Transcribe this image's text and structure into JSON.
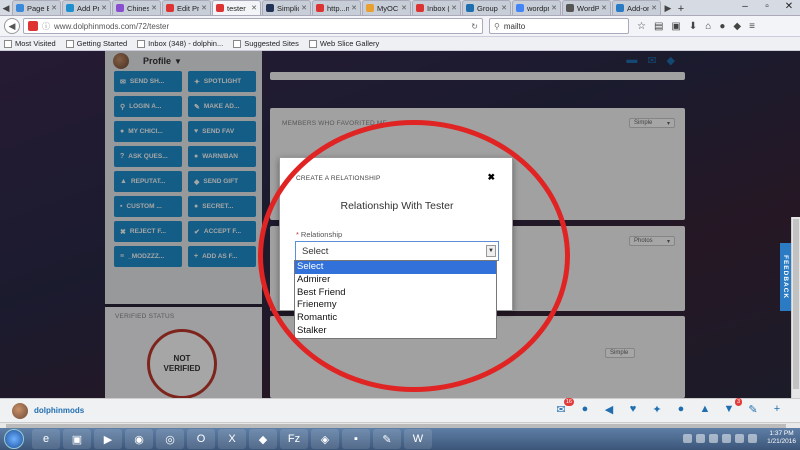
{
  "browser": {
    "tabs": [
      {
        "label": "Page Buil...",
        "icon_color": "#3b8ad9",
        "active": false
      },
      {
        "label": "Add Prod...",
        "icon_color": "#1f8fce",
        "active": false
      },
      {
        "label": "Chinese ...",
        "icon_color": "#8a4fd0",
        "active": false
      },
      {
        "label": "Edit Profile",
        "icon_color": "#d33",
        "active": false
      },
      {
        "label": "tester",
        "icon_color": "#d33",
        "active": true
      },
      {
        "label": "Simplicity",
        "icon_color": "#235",
        "active": false
      },
      {
        "label": "http...mods",
        "icon_color": "#d33",
        "active": false
      },
      {
        "label": "MyOC · D...",
        "icon_color": "#e8a030",
        "active": false
      },
      {
        "label": "Inbox (32...",
        "icon_color": "#d33",
        "active": false
      },
      {
        "label": "Group RS...",
        "icon_color": "#1f6fb0",
        "active": false
      },
      {
        "label": "wordpres...",
        "icon_color": "#4285f4",
        "active": false
      },
      {
        "label": "WordPres...",
        "icon_color": "#555",
        "active": false
      },
      {
        "label": "Add-ons ...",
        "icon_color": "#2a7bc4",
        "active": false
      }
    ],
    "url": "www.dolphinmods.com/72/tester",
    "search_value": "mailto",
    "bookmarks": [
      "Most Visited",
      "Getting Started",
      "Inbox (348) - dolphin...",
      "Suggested Sites",
      "Web Slice Gallery"
    ]
  },
  "page": {
    "profile_label": "Profile",
    "top_buttons": [
      "",
      ""
    ],
    "buttons": [
      {
        "label": "SEND SH...",
        "icon": "megaphone-icon",
        "glyph": "✉"
      },
      {
        "label": "SPOTLIGHT",
        "icon": "spotlight-icon",
        "glyph": "✦"
      },
      {
        "label": "LOGIN A...",
        "icon": "search-icon",
        "glyph": "⚲"
      },
      {
        "label": "MAKE AD...",
        "icon": "pen-icon",
        "glyph": "✎"
      },
      {
        "label": "MY CHICI...",
        "icon": "chat-icon",
        "glyph": "●"
      },
      {
        "label": "SEND FAV",
        "icon": "heart-icon",
        "glyph": "♥"
      },
      {
        "label": "ASK QUES...",
        "icon": "question-icon",
        "glyph": "?"
      },
      {
        "label": "WARN/BAN",
        "icon": "warning-icon",
        "glyph": "●"
      },
      {
        "label": "REPUTAT...",
        "icon": "thumbs-up-icon",
        "glyph": "▲"
      },
      {
        "label": "SEND GIFT",
        "icon": "gift-icon",
        "glyph": "◆"
      },
      {
        "label": "CUSTOM ...",
        "icon": "custom-icon",
        "glyph": "▪"
      },
      {
        "label": "SECRET...",
        "icon": "secret-icon",
        "glyph": "●"
      },
      {
        "label": "REJECT F...",
        "icon": "reject-icon",
        "glyph": "✖"
      },
      {
        "label": "ACCEPT F...",
        "icon": "accept-icon",
        "glyph": "✔"
      },
      {
        "label": "_MODZZZ...",
        "icon": "list-icon",
        "glyph": "≡"
      },
      {
        "label": "ADD AS F...",
        "icon": "add-icon",
        "glyph": "+"
      }
    ],
    "verified_title": "VERIFIED STATUS",
    "verified_seal": [
      "NOT",
      "VERIFIED"
    ],
    "panels": {
      "favorited_title": "MEMBERS WHO FAVORITED ME",
      "favorited_view": "Simple",
      "photos_view": "Photos",
      "third_view": "Simple"
    }
  },
  "modal": {
    "header": "CREATE A RELATIONSHIP",
    "close_glyph": "✖",
    "title": "Relationship With Tester",
    "field_label": "Relationship",
    "required_mark": "*",
    "selected": "Select",
    "options": [
      "Select",
      "Admirer",
      "Best Friend",
      "Frienemy",
      "Romantic",
      "Stalker"
    ]
  },
  "feedback_label": "FEEDBACK",
  "userbar": {
    "username": "dolphinmods",
    "icons": [
      {
        "name": "mail-icon",
        "glyph": "✉",
        "badge": "16"
      },
      {
        "name": "group-icon",
        "glyph": "●",
        "badge": ""
      },
      {
        "name": "megaphone-icon",
        "glyph": "◀",
        "badge": ""
      },
      {
        "name": "heart-icon",
        "glyph": "♥",
        "badge": ""
      },
      {
        "name": "twitter-icon",
        "glyph": "✦",
        "badge": ""
      },
      {
        "name": "friends-icon",
        "glyph": "●",
        "badge": ""
      },
      {
        "name": "bell-icon",
        "glyph": "▲",
        "badge": ""
      },
      {
        "name": "cart-icon",
        "glyph": "▼",
        "badge": "3"
      },
      {
        "name": "wrench-icon",
        "glyph": "✎",
        "badge": ""
      },
      {
        "name": "plus-icon",
        "glyph": "+",
        "badge": ""
      }
    ]
  },
  "taskbar": {
    "apps": [
      "e",
      "▣",
      "▶",
      "◉",
      "◎",
      "O",
      "X",
      "◆",
      "Fz",
      "◈",
      "▪",
      "✎",
      "W"
    ],
    "time": "1:37 PM",
    "date": "1/21/2016"
  }
}
